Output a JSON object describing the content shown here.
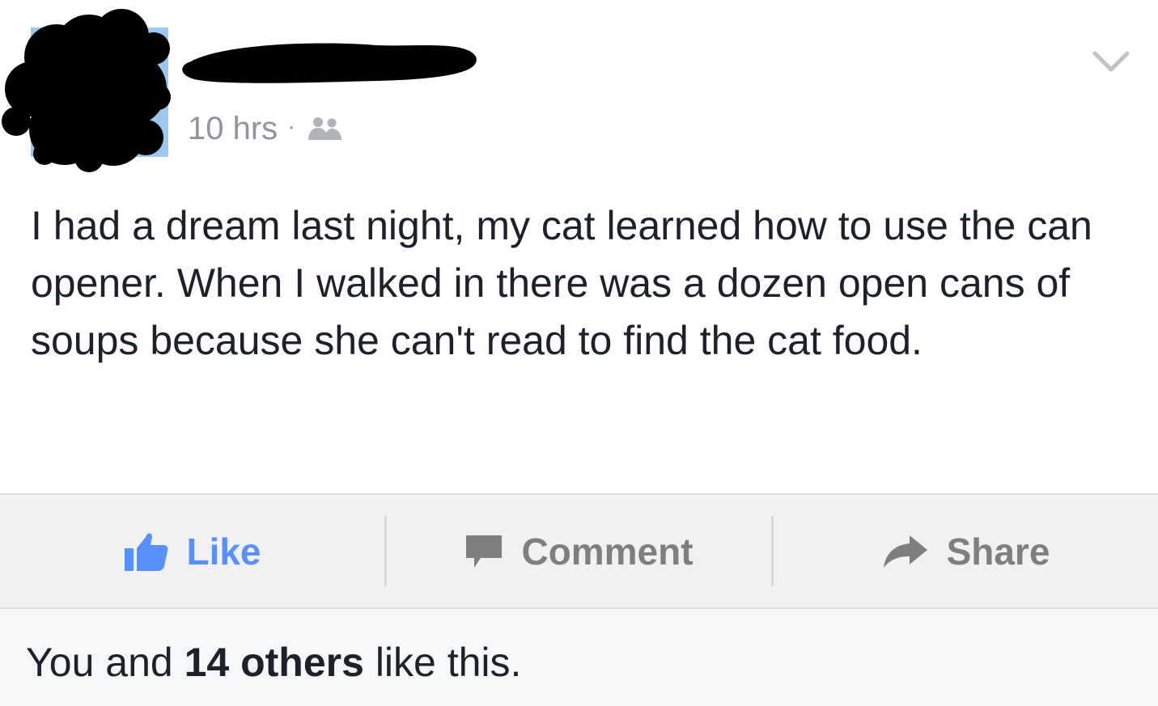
{
  "header": {
    "timestamp": "10 hrs",
    "separator": "·",
    "audience_icon": "friends-icon",
    "menu_icon": "chevron-down-icon",
    "avatar_redacted": true,
    "name_redacted": true
  },
  "post": {
    "text": "I had a dream last night, my cat learned how to use the can opener. When I walked in there was a dozen open cans of soups because she can't read to find the cat food."
  },
  "actions": {
    "like_label": "Like",
    "comment_label": "Comment",
    "share_label": "Share",
    "like_icon": "thumbs-up-icon",
    "comment_icon": "speech-bubble-icon",
    "share_icon": "share-arrow-icon"
  },
  "likes": {
    "prefix": "You and ",
    "count_text": "14 others",
    "suffix": " like this."
  },
  "colors": {
    "like_blue": "#5890ff",
    "action_gray": "#7f7f7f",
    "text": "#1d2129",
    "meta_gray": "#90949c",
    "redaction": "#000000"
  }
}
